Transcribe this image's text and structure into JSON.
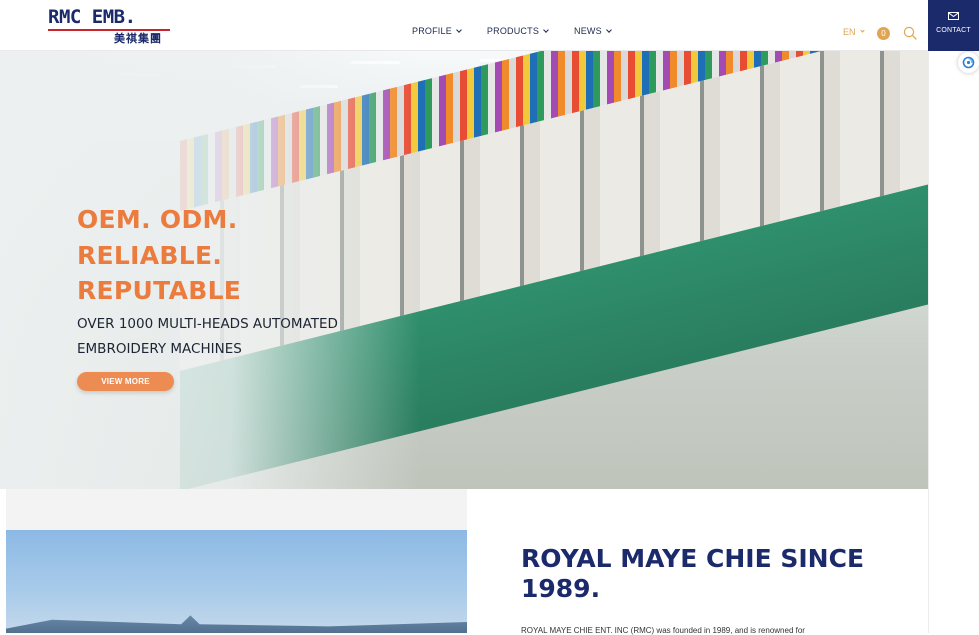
{
  "header": {
    "logo_text": "RMC EMB.",
    "logo_sub": "美祺集團",
    "nav": [
      {
        "label": "PROFILE"
      },
      {
        "label": "PRODUCTS"
      },
      {
        "label": "NEWS"
      }
    ],
    "language": "EN",
    "cart_count": "0",
    "contact_label": "CONTACT"
  },
  "hero": {
    "title_lines": [
      "OEM. ODM.",
      "RELIABLE.",
      "REPUTABLE"
    ],
    "subtitle_lines": [
      "OVER 1000 MULTI-HEADS AUTOMATED",
      "EMBROIDERY MACHINES"
    ],
    "cta_label": "VIEW MORE"
  },
  "about": {
    "title": "ROYAL MAYE CHIE SINCE 1989.",
    "text": "ROYAL MAYE CHIE ENT. INC (RMC) was founded in 1989, and is renowned for"
  },
  "colors": {
    "brand_navy": "#1b2a6b",
    "accent_orange": "#ec7b3e",
    "logo_red": "#c8242b"
  },
  "icons": [
    "chevron-down-icon",
    "search-icon",
    "mail-icon",
    "chat-icon"
  ]
}
